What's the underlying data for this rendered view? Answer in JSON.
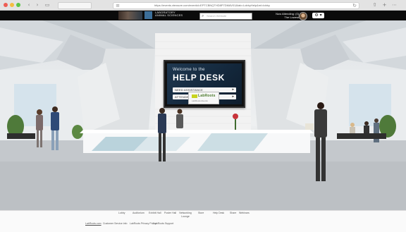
{
  "browser": {
    "url": "https://events.vtexsure.com/eventid=EPTCBNQTHD8P7DMAV01&tab=LobbyHelp&ml=lobby",
    "back_glyph": "‹",
    "forward_glyph": "›",
    "reload_glyph": "↻",
    "share_glyph": "⇧",
    "add_glyph": "+",
    "menu_glyph": "⋯"
  },
  "header": {
    "logo_line1": "LABORATORY",
    "logo_line2": "ANIMAL SCIENCES",
    "search_placeholder": "Search Website",
    "user_line1": "Now Attending: (0)",
    "user_line2": "The Lowest",
    "settings_glyph": "⚙ ▾"
  },
  "help_desk": {
    "welcome": "Welcome to the",
    "title": "HELP DESK",
    "menu": [
      {
        "label": "NEED ASSISTANCE",
        "chevron": "▸"
      },
      {
        "label": "ATTENDEE GUIDE",
        "chevron": "▸"
      }
    ]
  },
  "desk_sign": {
    "name": "LabRoots",
    "sub": "LabRoots Events"
  },
  "footer": {
    "links": [
      "Lobby",
      "Auditorium",
      "Exhibit Hall",
      "Poster Hall",
      "Networking Lounge",
      "Store",
      "Help Desk",
      "Share",
      "Webinars"
    ],
    "bottom": [
      "LabRoots.com",
      "Customer Service info",
      "LabRoots Privacy Policy",
      "LabRoots Support"
    ]
  },
  "colors": {
    "header_bg": "#0b0b0b",
    "screen_bg": "#13273b",
    "accent_green": "#c8d41f"
  }
}
